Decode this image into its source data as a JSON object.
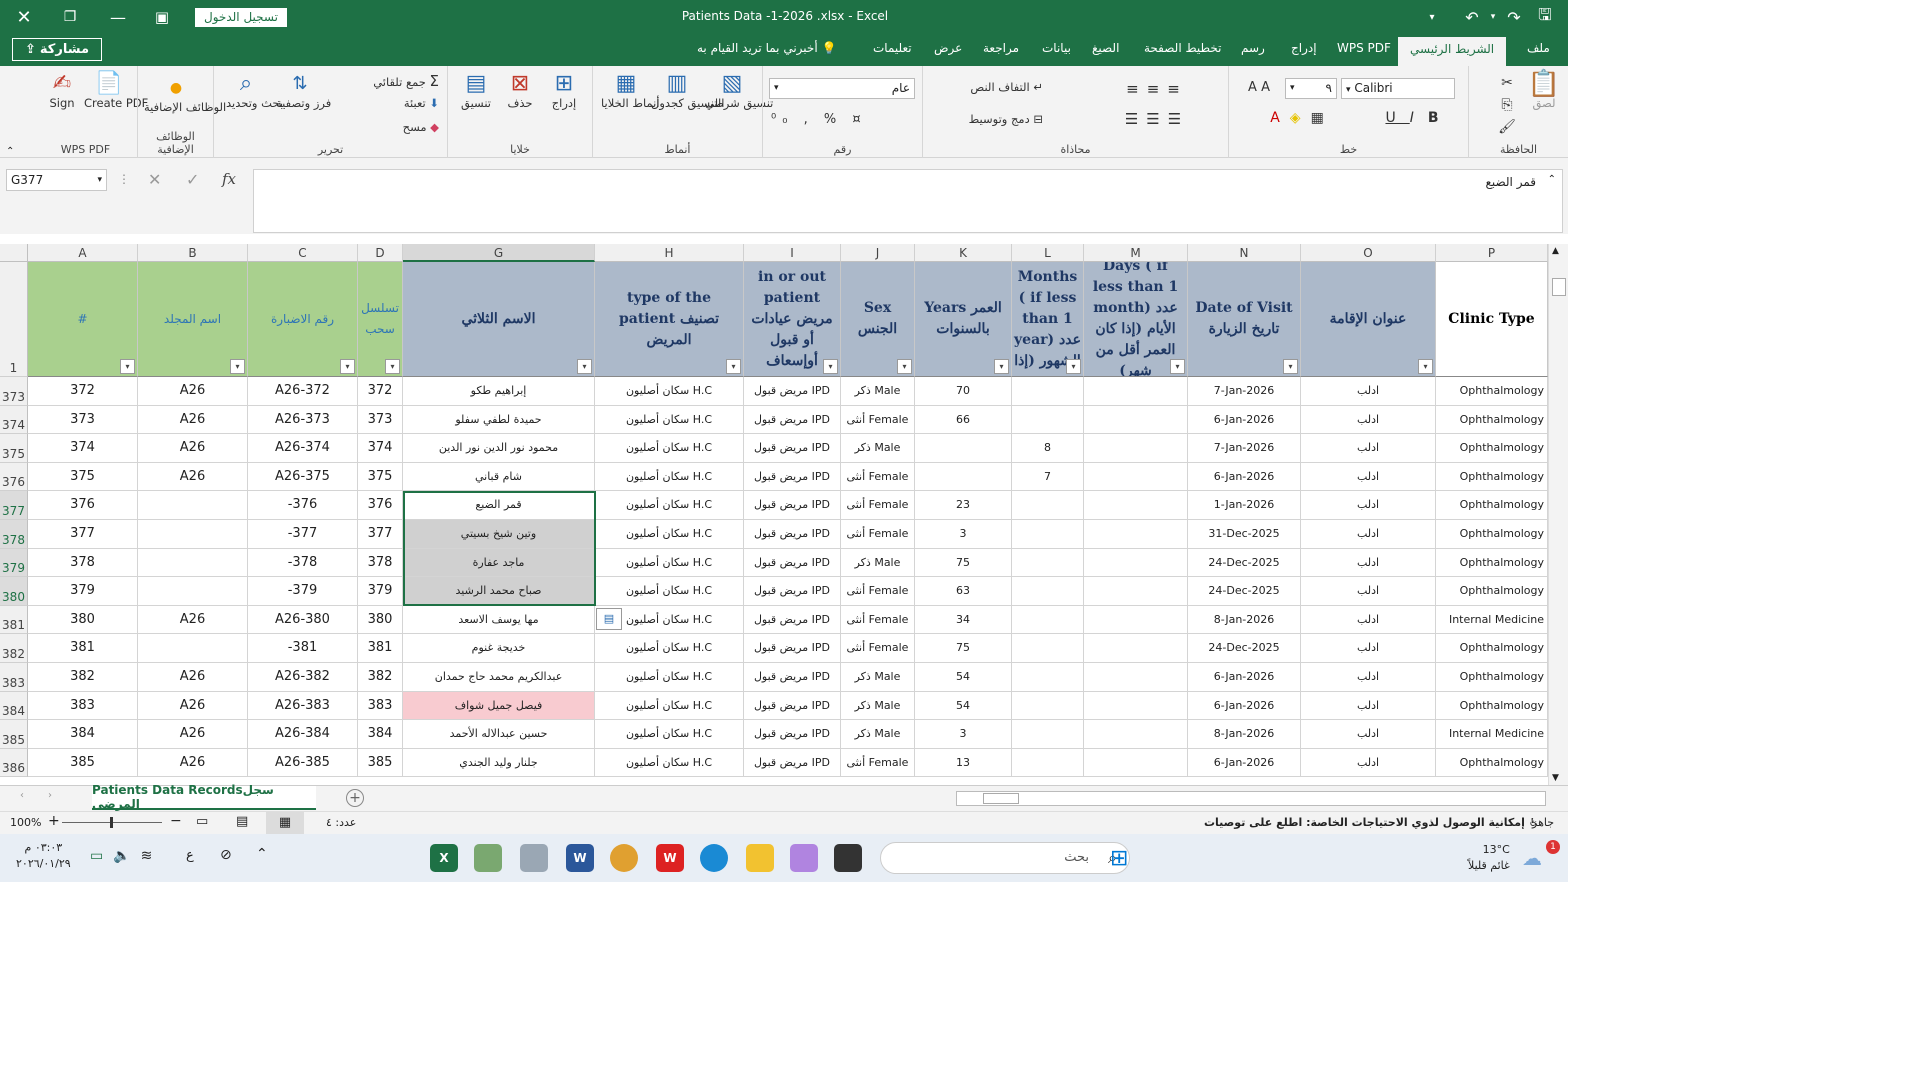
{
  "titlebar": {
    "signin": "تسجيل الدخول",
    "title": "Patients Data -1-2026 .xlsx  -  Excel"
  },
  "tabs": {
    "share": "مشاركة",
    "items": [
      "ملف",
      "الشريط الرئيسي",
      "WPS PDF",
      "إدراج",
      "رسم",
      "تخطيط الصفحة",
      "الصيغ",
      "بيانات",
      "مراجعة",
      "عرض",
      "تعليمات"
    ],
    "tellme": "أخبرني بما تريد القيام به"
  },
  "ribbon": {
    "clipboard": {
      "label": "الحافظة",
      "paste": "لصق"
    },
    "font": {
      "label": "خط",
      "name": "Calibri",
      "size": "٩",
      "bold": "B",
      "italic": "I",
      "underline": "U"
    },
    "alignment": {
      "label": "محاذاة",
      "wrap": "التفاف النص",
      "merge": "دمج وتوسيط"
    },
    "number": {
      "label": "رقم",
      "format": "عام"
    },
    "styles": {
      "label": "أنماط",
      "cond": "تنسيق شرطي",
      "table": "التنسيق كجدول",
      "cell": "أنماط الخلايا"
    },
    "cells": {
      "label": "خلايا",
      "insert": "إدراج",
      "delete": "حذف",
      "format": "تنسيق"
    },
    "editing": {
      "label": "تحرير",
      "autosum": "جمع تلقائي",
      "fill": "تعبئة",
      "clear": "مسح",
      "sort": "فرز وتصفية",
      "find": "بحث وتحديد"
    },
    "addins": {
      "label": "الوظائف الإضافية",
      "btn": "الوظائف الإضافية"
    },
    "wps": {
      "label": "WPS PDF",
      "create": "Create PDF",
      "sign": "Sign"
    }
  },
  "formula": {
    "namebox": "G377",
    "value": "قمر الضبع"
  },
  "columns": [
    {
      "letter": "A",
      "header": "#"
    },
    {
      "letter": "B",
      "header": "اسم المجلد"
    },
    {
      "letter": "C",
      "header": "رقم الاضبارة"
    },
    {
      "letter": "D",
      "header": "تسلسل سحب"
    },
    {
      "letter": "G",
      "header": "الاسم الثلاثي"
    },
    {
      "letter": "H",
      "header": "type of the patient تصنيف المريض"
    },
    {
      "letter": "I",
      "header": "in or out patient مريض عيادات أو قبول أوإسعاف"
    },
    {
      "letter": "J",
      "header": "Sex الجنس"
    },
    {
      "letter": "K",
      "header": "Years العمر بالسنوات"
    },
    {
      "letter": "L",
      "header": "Months ( if less than 1 year) عدد الشهور (إذا"
    },
    {
      "letter": "M",
      "header": "Days ( if less than 1 month) عدد الأيام (إذا كان العمر أقل من شهر)"
    },
    {
      "letter": "N",
      "header": "Date of Visit تاريخ الزيارة"
    },
    {
      "letter": "O",
      "header": "عنوان الإقامة"
    },
    {
      "letter": "P",
      "header": "Clinic Type"
    }
  ],
  "header_row_num": "1",
  "rows": [
    {
      "n": "373",
      "cells": [
        "372",
        "A26",
        "A26-372",
        "372",
        "إبراهيم طكو",
        "سكان أصليون H.C",
        "مريض قبول IPD",
        "ذكر Male",
        "70",
        "",
        "",
        "7-Jan-2026",
        "ادلب",
        "Ophthalmology"
      ]
    },
    {
      "n": "374",
      "cells": [
        "373",
        "A26",
        "A26-373",
        "373",
        "حميدة لطفي سفلو",
        "سكان أصليون H.C",
        "مريض قبول IPD",
        "أنثى Female",
        "66",
        "",
        "",
        "6-Jan-2026",
        "ادلب",
        "Ophthalmology"
      ]
    },
    {
      "n": "375",
      "cells": [
        "374",
        "A26",
        "A26-374",
        "374",
        "محمود نور الدين نور الدين",
        "سكان أصليون H.C",
        "مريض قبول IPD",
        "ذكر Male",
        "",
        "8",
        "",
        "7-Jan-2026",
        "ادلب",
        "Ophthalmology"
      ]
    },
    {
      "n": "376",
      "cells": [
        "375",
        "A26",
        "A26-375",
        "375",
        "شام قباني",
        "سكان أصليون H.C",
        "مريض قبول IPD",
        "أنثى Female",
        "",
        "7",
        "",
        "6-Jan-2026",
        "ادلب",
        "Ophthalmology"
      ]
    },
    {
      "n": "377",
      "cells": [
        "376",
        "",
        "-376",
        "376",
        "قمر الضبع",
        "سكان أصليون H.C",
        "مريض قبول IPD",
        "أنثى Female",
        "23",
        "",
        "",
        "1-Jan-2026",
        "ادلب",
        "Ophthalmology"
      ]
    },
    {
      "n": "378",
      "cells": [
        "377",
        "",
        "-377",
        "377",
        "وتين شيخ بسيتي",
        "سكان أصليون H.C",
        "مريض قبول IPD",
        "أنثى Female",
        "3",
        "",
        "",
        "31-Dec-2025",
        "ادلب",
        "Ophthalmology"
      ]
    },
    {
      "n": "379",
      "cells": [
        "378",
        "",
        "-378",
        "378",
        "ماجد عفارة",
        "سكان أصليون H.C",
        "مريض قبول IPD",
        "ذكر Male",
        "75",
        "",
        "",
        "24-Dec-2025",
        "ادلب",
        "Ophthalmology"
      ]
    },
    {
      "n": "380",
      "cells": [
        "379",
        "",
        "-379",
        "379",
        "صباح محمد الرشيد",
        "سكان أصليون H.C",
        "مريض قبول IPD",
        "أنثى Female",
        "63",
        "",
        "",
        "24-Dec-2025",
        "ادلب",
        "Ophthalmology"
      ]
    },
    {
      "n": "381",
      "cells": [
        "380",
        "A26",
        "A26-380",
        "380",
        "مها يوسف الاسعد",
        "سكان أصليون H.C",
        "مريض قبول IPD",
        "أنثى Female",
        "34",
        "",
        "",
        "8-Jan-2026",
        "ادلب",
        "Internal Medicine"
      ]
    },
    {
      "n": "382",
      "cells": [
        "381",
        "",
        "-381",
        "381",
        "خديجة غنوم",
        "سكان أصليون H.C",
        "مريض قبول IPD",
        "أنثى Female",
        "75",
        "",
        "",
        "24-Dec-2025",
        "ادلب",
        "Ophthalmology"
      ]
    },
    {
      "n": "383",
      "cells": [
        "382",
        "A26",
        "A26-382",
        "382",
        "عبدالكريم محمد حاج حمدان",
        "سكان أصليون H.C",
        "مريض قبول IPD",
        "ذكر Male",
        "54",
        "",
        "",
        "6-Jan-2026",
        "ادلب",
        "Ophthalmology"
      ]
    },
    {
      "n": "384",
      "cells": [
        "383",
        "A26",
        "A26-383",
        "383",
        "فيصل جميل شواف",
        "سكان أصليون H.C",
        "مريض قبول IPD",
        "ذكر Male",
        "54",
        "",
        "",
        "6-Jan-2026",
        "ادلب",
        "Ophthalmology"
      ]
    },
    {
      "n": "385",
      "cells": [
        "384",
        "A26",
        "A26-384",
        "384",
        "حسين عبدالاله الأحمد",
        "سكان أصليون H.C",
        "مريض قبول IPD",
        "ذكر Male",
        "3",
        "",
        "",
        "8-Jan-2026",
        "ادلب",
        "Internal Medicine"
      ]
    },
    {
      "n": "386",
      "cells": [
        "385",
        "A26",
        "A26-385",
        "385",
        "جلنار وليد الجندي",
        "سكان أصليون H.C",
        "مريض قبول IPD",
        "أنثى Female",
        "13",
        "",
        "",
        "6-Jan-2026",
        "ادلب",
        "Ophthalmology"
      ]
    }
  ],
  "sheet": {
    "tab": "Patients Data Recordsسجل المرضى"
  },
  "status": {
    "ready": "جاهز",
    "access": "إمكانية الوصول لذوي الاحتياجات الخاصة: اطلع على توصيات",
    "count": "عدد: ٤",
    "zoom": "100%"
  },
  "taskbar": {
    "search": "بحث",
    "weather_temp": "13°C",
    "weather_desc": "غائم قليلاً",
    "time": "٠٣:٠٣ م",
    "date": "٢٠٢٦/٠١/٢٩",
    "lang": "ع",
    "badge": "1"
  },
  "colors": {
    "excel_green": "#1e7145",
    "header_green": "#a9d08e",
    "header_blue": "#acb9ca",
    "highlight_gray": "#d0d0d0",
    "highlight_pink": "#f8cbd0"
  }
}
